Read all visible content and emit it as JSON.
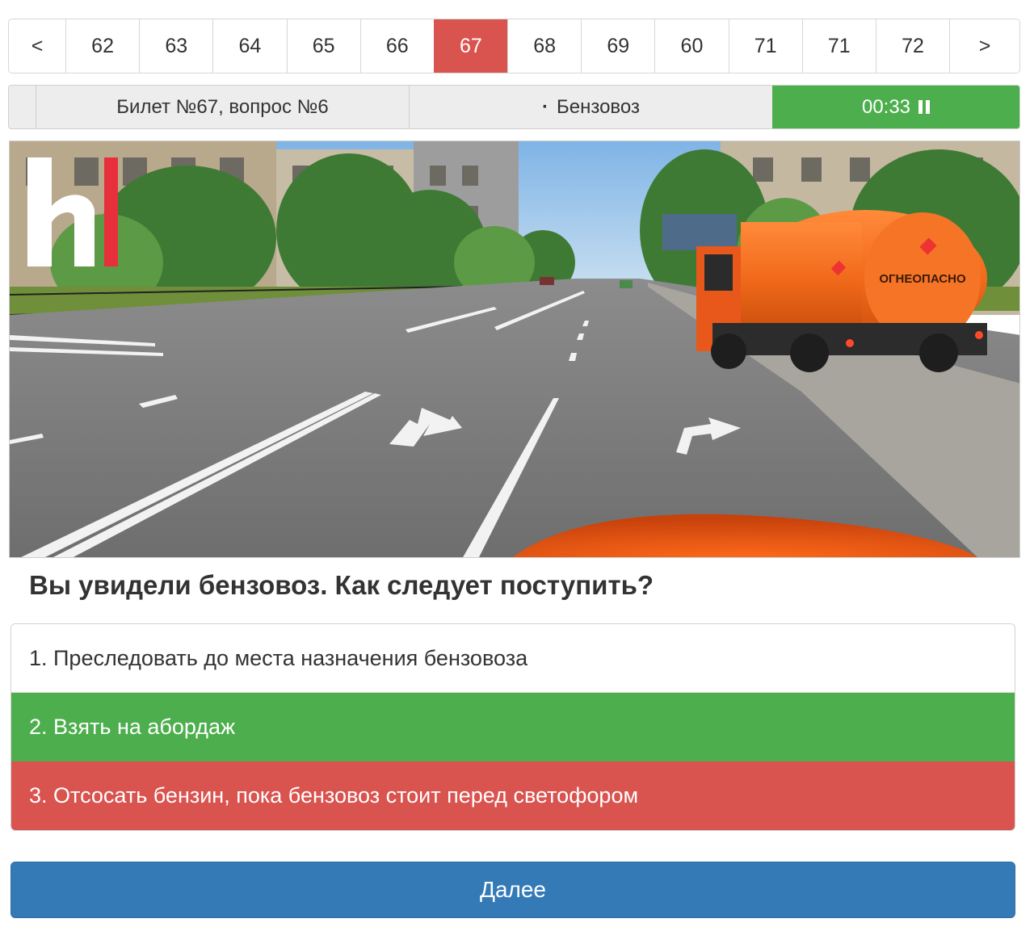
{
  "pagination": {
    "prev": "<",
    "next": ">",
    "pages": [
      "62",
      "63",
      "64",
      "65",
      "66",
      "67",
      "68",
      "69",
      "60",
      "71",
      "71",
      "72"
    ],
    "active_page": "67"
  },
  "status": {
    "ticket": "Билет №67, вопрос №6",
    "topic": "Бензовоз",
    "timer": "00:33",
    "timer_icon": "pause-icon"
  },
  "image": {
    "logo_letter": "h",
    "tanker_label": "ОГНЕОПАСНО"
  },
  "question": "Вы увидели бензовоз. Как следует поступить?",
  "answers": [
    {
      "text": "1. Преследовать до места назначения бензовоза",
      "state": "neutral"
    },
    {
      "text": "2. Взять на абордаж",
      "state": "correct"
    },
    {
      "text": "3. Отсосать бензин, пока бензовоз стоит перед светофором",
      "state": "wrong"
    }
  ],
  "next_button": "Далее",
  "colors": {
    "active": "#d9534f",
    "correct": "#4cae4c",
    "wrong": "#d9534f",
    "primary": "#337ab7",
    "tanker": "#f26a1b"
  }
}
